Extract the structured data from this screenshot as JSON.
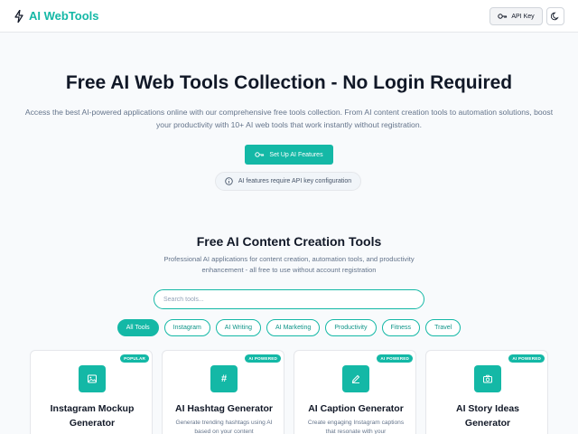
{
  "header": {
    "logo_text": "AI WebTools",
    "logo_icon": "lightning-icon",
    "api_key_label": "API Key",
    "theme_icon": "moon-icon"
  },
  "colors": {
    "accent": "#14b8a6",
    "accent_dark": "#0d9488",
    "text": "#111827",
    "muted": "#64748b"
  },
  "hero": {
    "title": "Free AI Web Tools Collection - No Login Required",
    "description": "Access the best AI-powered applications online with our comprehensive free tools collection. From AI content creation tools to automation solutions, boost your productivity with 10+ AI web tools that work instantly without registration.",
    "setup_button": "Set Up AI Features",
    "notice": "AI features require API key configuration"
  },
  "tools_section": {
    "title": "Free AI Content Creation Tools",
    "description": "Professional AI applications for content creation, automation tools, and productivity enhancement - all free to use without account registration",
    "search_placeholder": "Search tools...",
    "filters": [
      {
        "label": "All Tools",
        "active": true
      },
      {
        "label": "Instagram",
        "active": false
      },
      {
        "label": "AI Writing",
        "active": false
      },
      {
        "label": "AI Marketing",
        "active": false
      },
      {
        "label": "Productivity",
        "active": false
      },
      {
        "label": "Fitness",
        "active": false
      },
      {
        "label": "Travel",
        "active": false
      }
    ],
    "cards": [
      {
        "badge": "POPULAR",
        "icon": "image-icon",
        "title": "Instagram Mockup Generator",
        "description": ""
      },
      {
        "badge": "AI POWERED",
        "icon": "hashtag-icon",
        "title": "AI Hashtag Generator",
        "description": "Generate trending hashtags using AI based on your content"
      },
      {
        "badge": "AI POWERED",
        "icon": "pencil-icon",
        "title": "AI Caption Generator",
        "description": "Create engaging Instagram captions that resonate with your"
      },
      {
        "badge": "AI POWERED",
        "icon": "camera-icon",
        "title": "AI Story Ideas Generator",
        "description": ""
      }
    ]
  }
}
